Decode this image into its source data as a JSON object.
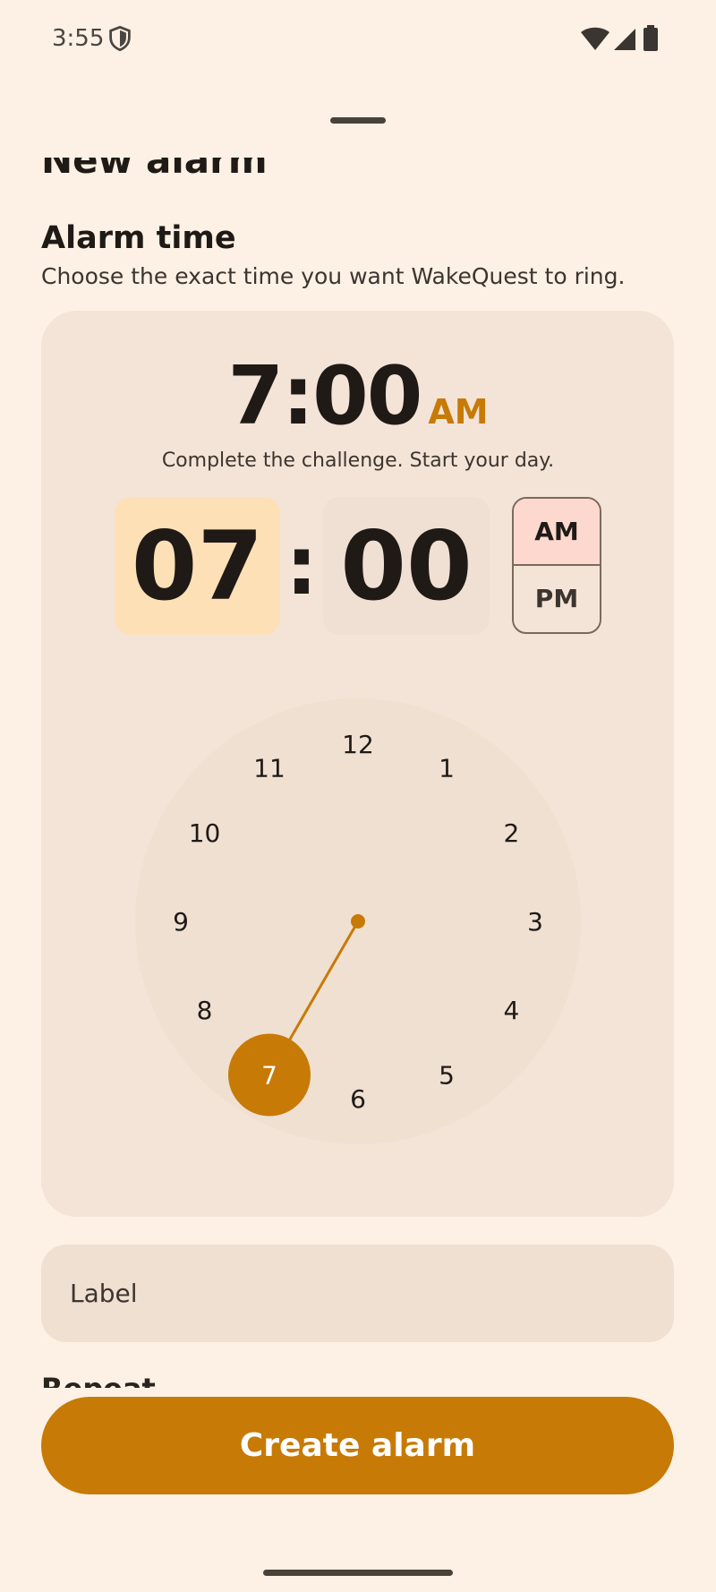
{
  "status_bar": {
    "time": "3:55"
  },
  "sheet": {
    "title": "New alarm",
    "section_title": "Alarm time",
    "section_subtitle": "Choose the exact time you want WakeQuest to ring."
  },
  "time_display": {
    "time": "7:00",
    "ampm": "AM",
    "tagline": "Complete the challenge. Start your day."
  },
  "picker": {
    "hour": "07",
    "separator": ":",
    "minute": "00",
    "am_label": "AM",
    "pm_label": "PM",
    "selected_period": "AM"
  },
  "clock": {
    "numbers": [
      "12",
      "1",
      "2",
      "3",
      "4",
      "5",
      "6",
      "7",
      "8",
      "9",
      "10",
      "11"
    ],
    "selected": "7"
  },
  "label_field": {
    "placeholder": "Label"
  },
  "next_section_partial": "Repeat",
  "create_button": {
    "label": "Create alarm"
  },
  "colors": {
    "accent": "#c77a05",
    "background": "#fdf0e4",
    "card": "#f3e4d7"
  }
}
